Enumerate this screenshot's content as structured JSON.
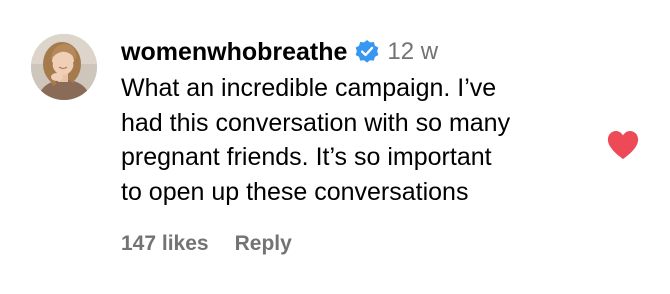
{
  "comment": {
    "username": "womenwhobreathe",
    "time": "12 w",
    "text_lines": [
      "What an incredible campaign. I’ve",
      "had this conversation with so many",
      "pregnant friends. It’s so important",
      "to open up these conversations"
    ],
    "likes": "147 likes",
    "reply": "Reply",
    "liked": true,
    "colors": {
      "heart": "#ed4956",
      "verified": "#3897f0",
      "secondary_text": "#737373"
    },
    "icons": {
      "verified": "verified-badge-icon",
      "like": "heart-icon"
    }
  }
}
